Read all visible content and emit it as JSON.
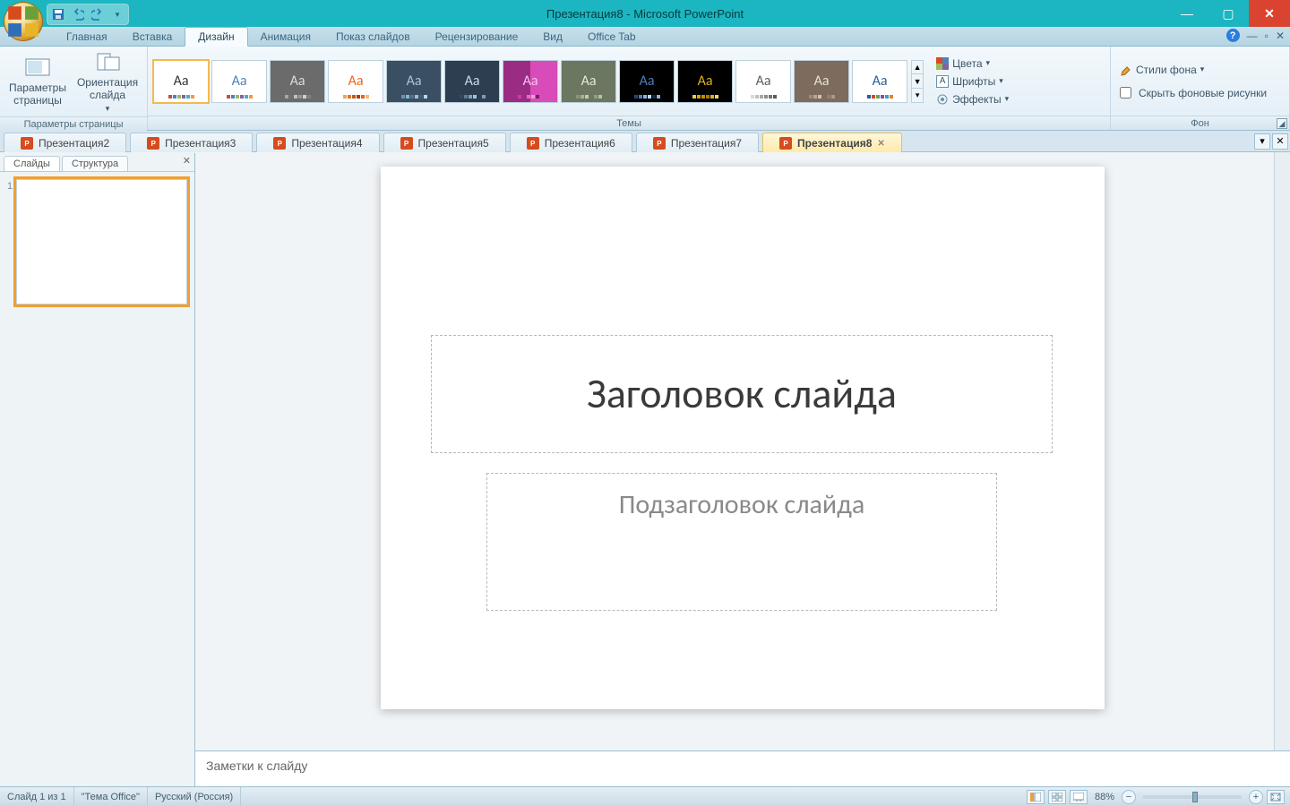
{
  "title": "Презентация8 - Microsoft PowerPoint",
  "menu": {
    "tabs": [
      "Главная",
      "Вставка",
      "Дизайн",
      "Анимация",
      "Показ слайдов",
      "Рецензирование",
      "Вид",
      "Office Tab"
    ],
    "active_index": 2
  },
  "ribbon": {
    "group_page": {
      "label": "Параметры страницы",
      "page_setup": "Параметры\nстраницы",
      "orientation": "Ориентация\nслайда"
    },
    "group_themes": {
      "label": "Темы"
    },
    "group_bg": {
      "label": "Фон",
      "colors": "Цвета",
      "fonts": "Шрифты",
      "effects": "Эффекты",
      "styles": "Стили фона",
      "hide": "Скрыть фоновые рисунки"
    }
  },
  "themes": [
    {
      "bg": "#ffffff",
      "aa": "#333333",
      "sel": true,
      "dots": [
        "#c0504d",
        "#4f81bd",
        "#9bbb59",
        "#8064a2",
        "#4bacc6",
        "#f79646"
      ]
    },
    {
      "bg": "#ffffff",
      "aa": "#4f81bd",
      "dots": [
        "#c0504d",
        "#4f81bd",
        "#9bbb59",
        "#8064a2",
        "#4bacc6",
        "#f79646"
      ]
    },
    {
      "bg": "#6b6b6b",
      "aa": "#dddddd",
      "dots": [
        "#a5a5a5",
        "#6f6f6f",
        "#bfbfbf",
        "#969696",
        "#d1d1d1",
        "#808080"
      ]
    },
    {
      "bg": "#ffffff",
      "aa": "#e8641b",
      "dots": [
        "#f0a35e",
        "#d87a2b",
        "#c0591c",
        "#a24111",
        "#e8641b",
        "#f7b97a"
      ]
    },
    {
      "bg": "#3b4f63",
      "aa": "#a9c4de",
      "dots": [
        "#6f90b1",
        "#87b4d0",
        "#527094",
        "#9fbfd8",
        "#3c5d7d",
        "#bcd4e4"
      ]
    },
    {
      "bg": "#2c3e50",
      "aa": "#c7def0",
      "dots": [
        "#34495e",
        "#5d7a94",
        "#82a3bb",
        "#a6c3d5",
        "#2c3e50",
        "#7f9cb0"
      ]
    },
    {
      "bg": "#9b2c84",
      "aa": "#f3c6ec",
      "bg2": "#d94bb8",
      "dots": [
        "#c73fa5",
        "#9b2c84",
        "#e26fc4",
        "#f09cd8",
        "#7e1c68",
        "#d94bb8"
      ]
    },
    {
      "bg": "#6b7760",
      "aa": "#e4e9dc",
      "dots": [
        "#8a9478",
        "#a5b293",
        "#c1ccaf",
        "#6b7760",
        "#929e7d",
        "#b6c29f"
      ]
    },
    {
      "bg": "#000000",
      "aa": "#4f81bd",
      "dots": [
        "#1f497d",
        "#4f81bd",
        "#8db3e2",
        "#c6d9f1",
        "#0f2b4a",
        "#95b3d7"
      ]
    },
    {
      "bg": "#000000",
      "aa": "#e0b318",
      "dots": [
        "#f0c843",
        "#d8a40d",
        "#c08f00",
        "#a97b00",
        "#e0b318",
        "#f5d769"
      ]
    },
    {
      "bg": "#ffffff",
      "aa": "#5b5b5b",
      "dots": [
        "#d9d9d9",
        "#bfbfbf",
        "#a6a6a6",
        "#8c8c8c",
        "#737373",
        "#595959"
      ]
    },
    {
      "bg": "#7d6b5d",
      "aa": "#e9e1d6",
      "dots": [
        "#a08b77",
        "#b8a690",
        "#cfc1ab",
        "#7d6b5d",
        "#93806c",
        "#ab9a85"
      ]
    },
    {
      "bg": "#ffffff",
      "aa": "#2e5b9b",
      "dots": [
        "#2e5b9b",
        "#c74c2f",
        "#6fa043",
        "#7a519e",
        "#2fa4c2",
        "#e2803b"
      ]
    }
  ],
  "doc_tabs": [
    {
      "label": "Презентация2"
    },
    {
      "label": "Презентация3"
    },
    {
      "label": "Презентация4"
    },
    {
      "label": "Презентация5"
    },
    {
      "label": "Презентация6"
    },
    {
      "label": "Презентация7"
    },
    {
      "label": "Презентация8",
      "active": true
    }
  ],
  "panel": {
    "slides": "Слайды",
    "outline": "Структура",
    "thumb_num": "1"
  },
  "slide": {
    "title_ph": "Заголовок слайда",
    "sub_ph": "Подзаголовок слайда"
  },
  "notes": {
    "placeholder": "Заметки к слайду"
  },
  "status": {
    "slide": "Слайд 1 из 1",
    "theme": "\"Тема Office\"",
    "lang": "Русский (Россия)",
    "zoom": "88%"
  }
}
